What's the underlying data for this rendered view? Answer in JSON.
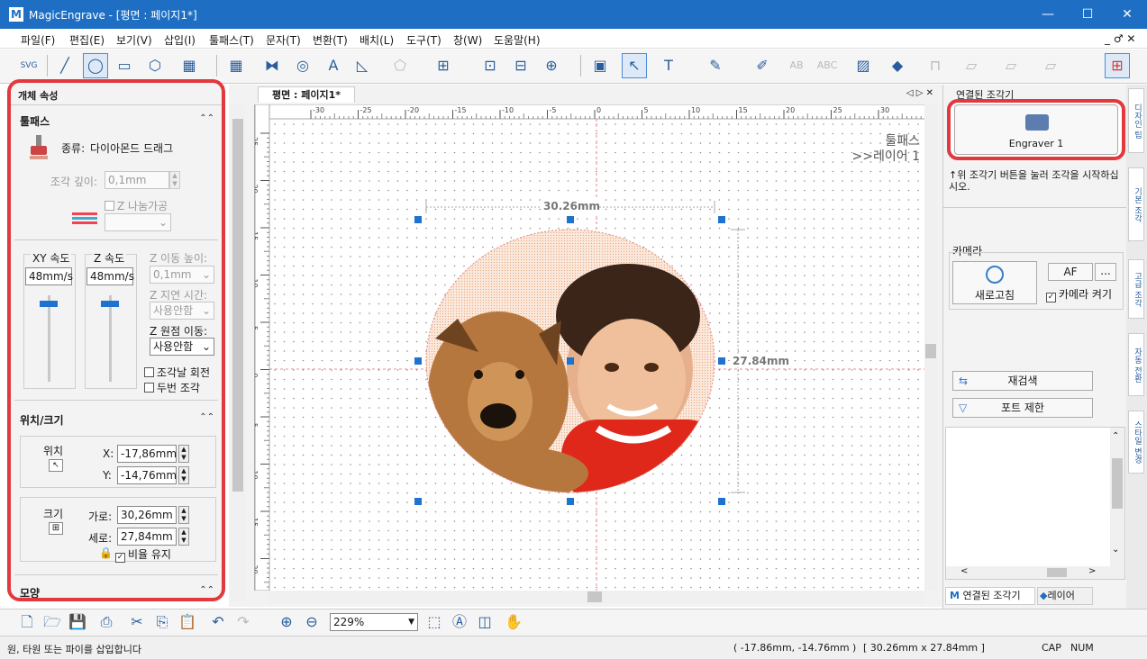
{
  "window": {
    "title": "MagicEngrave - [평면 : 페이지1*]",
    "logo": "M",
    "min": "—",
    "max": "☐",
    "close": "✕"
  },
  "menu": [
    "파일(F)",
    "편집(E)",
    "보기(V)",
    "삽입(I)",
    "툴패스(T)",
    "문자(T)",
    "변환(T)",
    "배치(L)",
    "도구(T)",
    "창(W)",
    "도움말(H)"
  ],
  "menu_right": "_ ♂ ✕",
  "left_panel": {
    "header": "개체 속성",
    "pin": "⊓",
    "toolpath": {
      "title": "툴패스",
      "type_label": "종류:",
      "type_value": "다이아몬드 드래그",
      "depth_label": "조각 깊이:",
      "depth_value": "0,1mm",
      "z_split_label": "Z 나눔가공",
      "xy_speed_label": "XY 속도",
      "xy_speed_value": "48mm/s",
      "z_speed_label": "Z 속도",
      "z_speed_value": "48mm/s",
      "z_move_height_label": "Z 이동 높이:",
      "z_move_height_value": "0,1mm",
      "z_delay_label": "Z 지연 시간:",
      "z_delay_value": "사용안함",
      "z_origin_label": "Z 원점 이동:",
      "z_origin_value": "사용안함",
      "rotate_label": "조각날 회전",
      "twice_label": "두번 조각"
    },
    "position_size": {
      "title": "위치/크기",
      "position_label": "위치",
      "x_label": "X:",
      "x_value": "-17,86mm",
      "y_label": "Y:",
      "y_value": "-14,76mm",
      "size_label": "크기",
      "width_label": "가로:",
      "width_value": "30,26mm",
      "height_label": "세로:",
      "height_value": "27,84mm",
      "ratio_label": "비율 유지",
      "ratio_checked": true
    },
    "shape_title": "모양"
  },
  "document": {
    "tab": "평면 : 페이지1*",
    "tab_nav": "◁ ▷ ✕",
    "ruler_h_ticks": [
      "-30",
      "-25",
      "-20",
      "-15",
      "-10",
      "-5",
      "0",
      "5",
      "10",
      "15",
      "20",
      "25",
      "30",
      "35"
    ],
    "ruler_v_ticks": [
      "25",
      "20",
      "15",
      "10",
      "5",
      "0",
      "-5",
      "-10",
      "-15",
      "-20",
      "-25"
    ],
    "toolpath_layer_line1": "툴패스",
    "toolpath_layer_line2": ">>레이어 1",
    "dim_width": "30.26mm",
    "dim_height": "27.84mm"
  },
  "right_panel": {
    "title": "연결된 조각기",
    "engraver_name": "Engraver 1",
    "hint": "↑위 조각기 버튼을 눌러 조각을 시작하십시오.",
    "camera_title": "카메라",
    "refresh_label": "새로고침",
    "af_label": "AF",
    "more_label": "...",
    "camera_on_label": "카메라 켜기",
    "rescan_label": "재검색",
    "port_limit_label": "포트 제한",
    "bottom_tab1": "연결된 조각기",
    "bottom_tab2": "레이어"
  },
  "side_tabs": [
    "디자인 팁",
    "기본 조각",
    "고급 조각",
    "자동 전환",
    "스타일 변경"
  ],
  "bottom_toolbar": {
    "zoom_value": "229%"
  },
  "status": {
    "message": "원, 타원 또는 파이를 삽입합니다",
    "coords": "( -17.86mm, -14.76mm )",
    "size": "[ 30.26mm x 27.84mm ]",
    "cap": "CAP",
    "num": "NUM"
  },
  "colors": {
    "title_bar": "#1e6fc4",
    "highlight": "#e2393e",
    "accent": "#1e73d0"
  }
}
